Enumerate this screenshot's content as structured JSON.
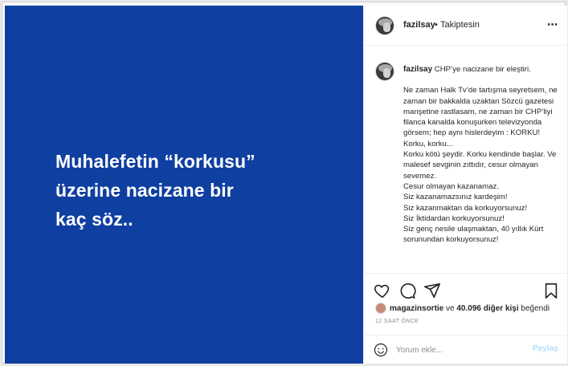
{
  "post": {
    "headline": "Muhalefetin “korkusu”\nüzerine nacizane  bir\nkaç söz..",
    "colors": {
      "image_bg": "#0f3fa0",
      "link_blue": "#b2dffc"
    }
  },
  "header": {
    "username": "fazilsay",
    "separator": "•",
    "follow_status": "Takiptesin",
    "more_icon": "⋯"
  },
  "caption": {
    "username": "fazilsay",
    "text": " CHP’ye nacizane bir eleştiri.",
    "body": "Ne zaman Halk Tv’de tartışma seyretsem, ne zaman bir bakkalda uzaktan Sözcü gazetesi manşetine rastlasam, ne zaman bir CHP’liyi filanca kanalda konuşurken televizyonda görsem; hep aynı hislerdeyim : KORKU!\nKorku, korku...\nKorku kötü şeydir. Korku kendinde başlar. Ve malesef sevginin zıttıdır, cesur olmayan sevemez.\nCesur olmayan kazanamaz.\nSiz kazanamazsınız kardeşim!\nSiz kazanmaktan da korkuyorsunuz!\nSiz İktidardan korkuyorsunuz!\nSiz genç nesile ulaşmaktan, 40 yıllık Kürt sorunundan korkuyorsunuz!"
  },
  "actions": {
    "icons": [
      "heart-icon",
      "comment-icon",
      "share-icon",
      "bookmark-icon"
    ],
    "likes_user": "magazinsortie",
    "likes_middle": " ve ",
    "likes_count": "40.096 diğer kişi",
    "likes_suffix": " beğendi",
    "timestamp": "12 SAAT ÖNCE"
  },
  "comment": {
    "placeholder": "Yorum ekle...",
    "post_label": "Paylaş"
  }
}
